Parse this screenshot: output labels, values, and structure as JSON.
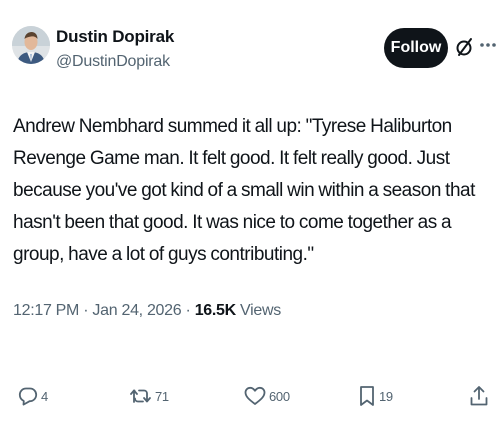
{
  "author": {
    "display_name": "Dustin Dopirak",
    "handle": "@DustinDopirak"
  },
  "header_actions": {
    "follow_label": "Follow",
    "grok_icon": "grok-icon",
    "more_icon": "more-dots-icon"
  },
  "tweet": {
    "text": "Andrew Nembhard summed it all up: \"Tyrese Haliburton Revenge Game man. It felt good. It felt really good. Just because you've got kind of a small win within a season that hasn't been that good. It was nice to come together as a group, have a lot of guys contributing.\""
  },
  "meta": {
    "time": "12:17 PM",
    "date": "Jan 24, 2026",
    "views_count": "16.5K",
    "views_label": "Views"
  },
  "actions": {
    "replies": "4",
    "reposts": "71",
    "likes": "600",
    "bookmarks": "19"
  },
  "colors": {
    "text": "#0f1419",
    "secondary": "#536471",
    "follow_bg": "#0f1419",
    "follow_text": "#ffffff"
  }
}
